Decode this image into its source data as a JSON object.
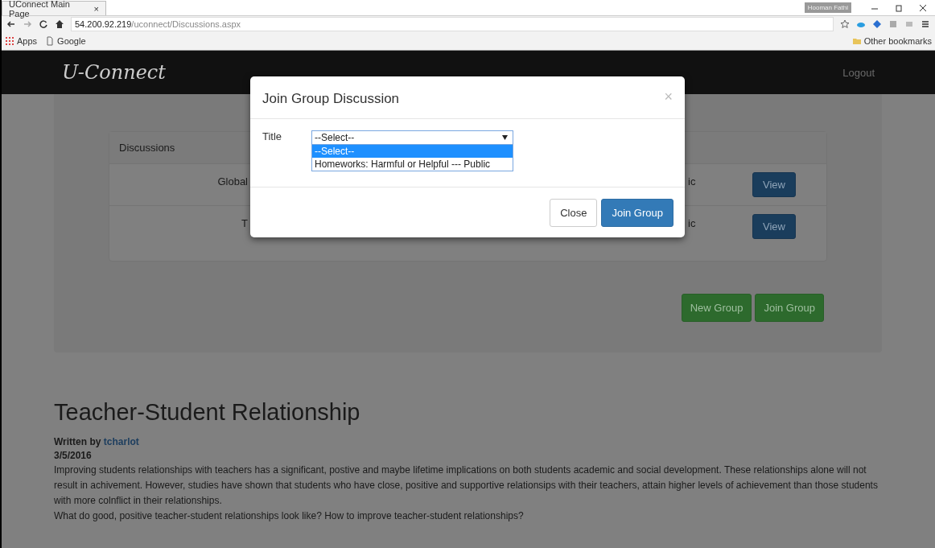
{
  "browser": {
    "tab_title": "UConnect Main Page",
    "tab_close": "×",
    "url_host": "54.200.92.219",
    "url_path": "/uconnect/Discussions.aspx",
    "user_badge": "Hooman Fathi",
    "bookmarks": [
      "Apps",
      "Google"
    ],
    "other_bookmarks": "Other bookmarks"
  },
  "navbar": {
    "logo": "U-Connect",
    "logout": "Logout"
  },
  "discussions": {
    "heading": "Discussions",
    "rows": [
      {
        "title": "Global",
        "visibility": "ic",
        "action": "View"
      },
      {
        "title": "T",
        "visibility": "ic",
        "action": "View"
      }
    ]
  },
  "actions": [
    "New Group",
    "Join Group"
  ],
  "article": {
    "title": "Teacher-Student Relationship",
    "byline": "Written by",
    "author": "tcharlot",
    "date": "3/5/2016",
    "paragraphs": [
      "Improving students relationships with teachers has a significant, postive and maybe lifetime implications on both students academic and social development. These relationships alone will not result in achivement. However, studies have shown that students who have close, positive and supportive relationsips with their teachers, attain higher levels of achievement than those students with more colnflict in their relationships.",
      "What do good, positive teacher-student relationships look like? How to improve teacher-student relationships?"
    ]
  },
  "modal": {
    "title": "Join Group Discussion",
    "close": "×",
    "field": {
      "label": "Title",
      "value": "--Select--",
      "expanded": true,
      "options": [
        {
          "label": "--Select--",
          "selected": true
        },
        {
          "label": "Homeworks: Harmful or Helpful --- Public",
          "selected": false
        }
      ]
    },
    "buttons": [
      {
        "label": "Close",
        "kind": "default"
      },
      {
        "label": "Join Group",
        "kind": "primary"
      }
    ]
  }
}
